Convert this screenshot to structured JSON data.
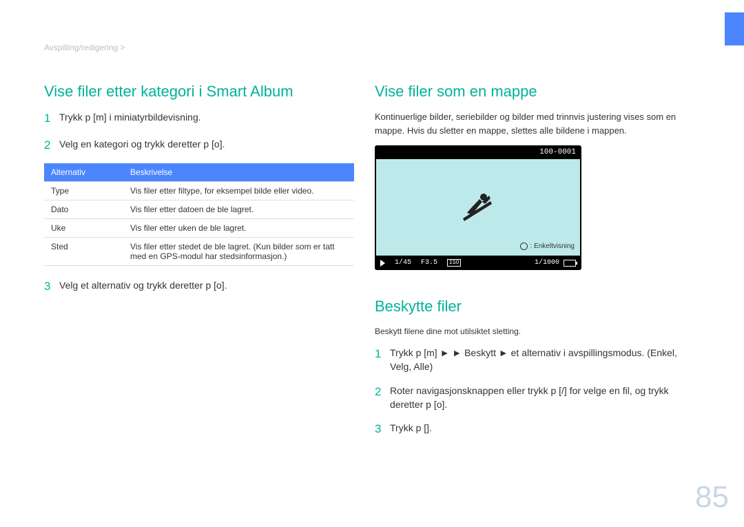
{
  "breadcrumb": "Avspilling/redigering >",
  "page_number": "85",
  "left": {
    "heading": "Vise ﬁler etter kategori i Smart Album",
    "step1": {
      "num": "1",
      "text": "Trykk p [m] i miniatyrbildevisning."
    },
    "step2": {
      "num": "2",
      "text": "Velg en kategori og trykk deretter p [o]."
    },
    "table": {
      "h1": "Alternativ",
      "h2": "Beskrivelse",
      "rows": [
        {
          "c1": "Type",
          "c2": "Vis ﬁler etter ﬁltype, for eksempel bilde eller video."
        },
        {
          "c1": "Dato",
          "c2": "Vis ﬁler etter datoen de ble lagret."
        },
        {
          "c1": "Uke",
          "c2": "Vis ﬁler etter uken de ble lagret."
        },
        {
          "c1": "Sted",
          "c2": "Vis ﬁler etter stedet de ble lagret. (Kun bilder som er tatt med en GPS-modul har stedsinformasjon.)"
        }
      ]
    },
    "step3": {
      "num": "3",
      "text": "Velg et alternativ og trykk deretter p [o]."
    }
  },
  "right": {
    "heading1": "Vise ﬁler som en mappe",
    "body1": "Kontinuerlige bilder, seriebilder og bilder med trinnvis justering vises som en mappe. Hvis du sletter en mappe, slettes alle bildene i mappen.",
    "camera": {
      "file_id": "100-0001",
      "hint": ": Enkeltvisning",
      "counter": "1/45",
      "fstop": "F3.5",
      "iso_label": "ISO",
      "shutter": "1/1000"
    },
    "heading2": "Beskytte ﬁler",
    "body2": "Beskytt ﬁlene dine mot utilsiktet sletting.",
    "p_step1": {
      "num": "1",
      "text": "Trykk p [m]   ►   ► Beskytt ► et alternativ i avspillingsmodus. (Enkel, Velg, Alle)"
    },
    "p_step2": {
      "num": "2",
      "text": "Roter navigasjonsknappen eller trykk p [/] for velge en ﬁl, og trykk deretter p [o]."
    },
    "p_step3": {
      "num": "3",
      "text": "Trykk p []."
    }
  }
}
